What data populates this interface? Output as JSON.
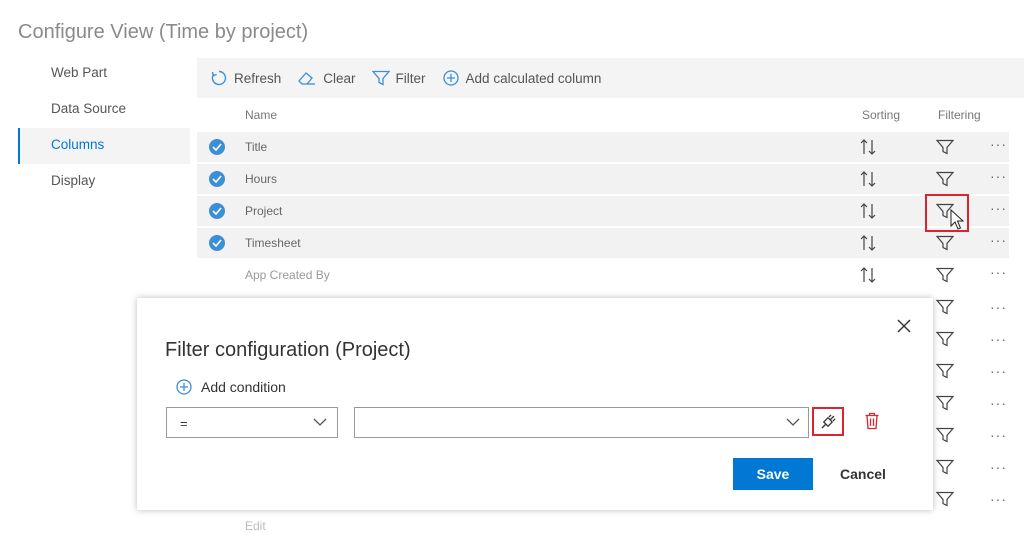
{
  "page": {
    "title": "Configure View (Time by project)"
  },
  "nav": {
    "items": [
      {
        "label": "Web Part",
        "active": false
      },
      {
        "label": "Data Source",
        "active": false
      },
      {
        "label": "Columns",
        "active": true
      },
      {
        "label": "Display",
        "active": false
      }
    ]
  },
  "toolbar": {
    "refresh_label": "Refresh",
    "clear_label": "Clear",
    "filter_label": "Filter",
    "add_calc_label": "Add calculated column"
  },
  "table": {
    "headers": {
      "name": "Name",
      "sorting": "Sorting",
      "filtering": "Filtering"
    },
    "rows": [
      {
        "name": "Title",
        "selected": true
      },
      {
        "name": "Hours",
        "selected": true
      },
      {
        "name": "Project",
        "selected": true
      },
      {
        "name": "Timesheet",
        "selected": true
      },
      {
        "name": "App Created By",
        "selected": false
      }
    ],
    "partial_row": "Edit"
  },
  "modal": {
    "title": "Filter configuration (Project)",
    "add_condition_label": "Add condition",
    "operator_value": "=",
    "value": "",
    "save_label": "Save",
    "cancel_label": "Cancel"
  },
  "colors": {
    "accent": "#0078d4",
    "highlight": "#d9252f",
    "check": "#3b8fd6",
    "toolbar_bg": "#f4f4f4"
  },
  "icons": {
    "refresh": "refresh-icon",
    "clear": "eraser-icon",
    "filter": "funnel-icon",
    "add": "plus-circle-icon",
    "sort": "sort-arrows-icon",
    "more": "ellipsis-icon",
    "close": "close-icon",
    "chevron": "chevron-down-icon",
    "dynamic": "plug-icon",
    "delete": "trash-icon"
  }
}
